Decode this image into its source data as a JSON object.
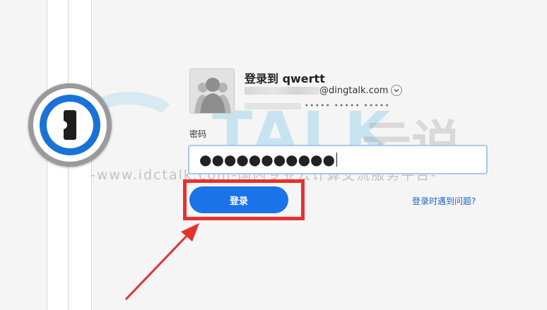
{
  "account": {
    "title": "登录到 qwertt",
    "email_domain": "@dingtalk.com",
    "secret_key_tail": "••••• ••••• •••••"
  },
  "password": {
    "label": "密码",
    "masked_value": "●●●●●●●●●●●"
  },
  "actions": {
    "login_label": "登录",
    "help_link": "登录时遇到问题?"
  },
  "watermark": {
    "brand": "TALK",
    "brand_cn": "云说",
    "tagline": "-www.idctalk.com-国内专业云计算交流服务平台-"
  },
  "icons": {
    "app_logo": "1password-keyhole-icon",
    "avatar": "group-avatar-icon",
    "account_switch": "chevron-down-icon"
  },
  "colors": {
    "primary_button": "#1a73e8",
    "highlight": "#e8302f",
    "link": "#1a66c7",
    "field_focus_border": "#a6c8ee"
  }
}
